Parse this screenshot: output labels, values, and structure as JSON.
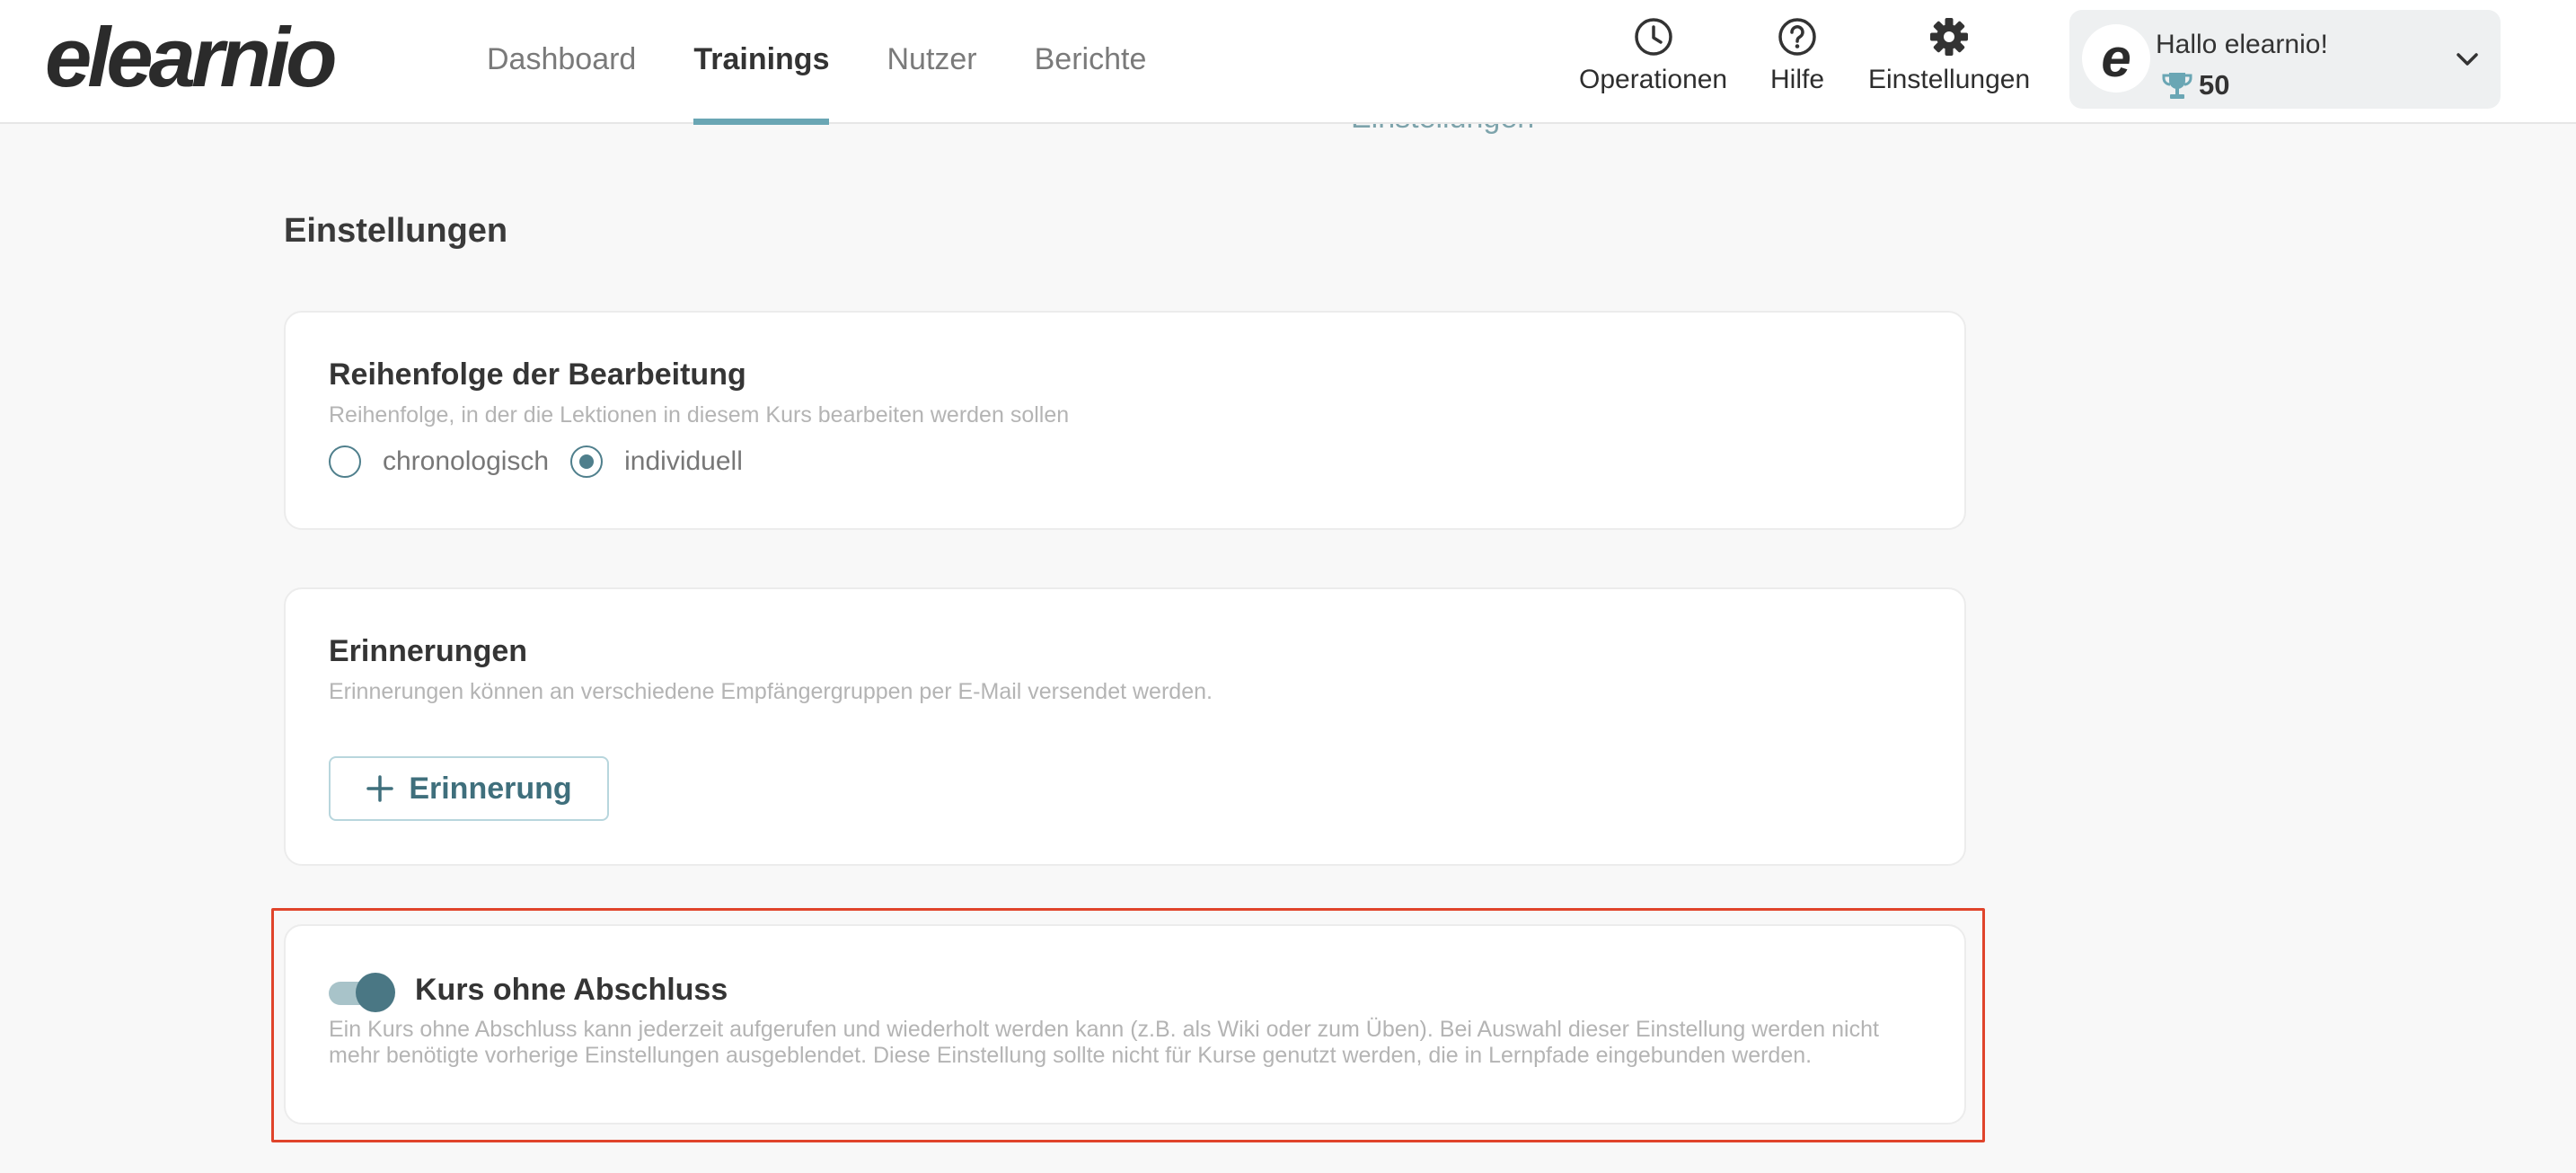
{
  "header": {
    "logo": "elearnio",
    "nav_tabs": [
      {
        "label": "Dashboard",
        "active": false
      },
      {
        "label": "Trainings",
        "active": true
      },
      {
        "label": "Nutzer",
        "active": false
      },
      {
        "label": "Berichte",
        "active": false
      }
    ],
    "icon_nav": {
      "operations": {
        "label": "Operationen",
        "icon": "clock-icon"
      },
      "help": {
        "label": "Hilfe",
        "icon": "help-circle-icon"
      },
      "settings": {
        "label": "Einstellungen",
        "icon": "gear-icon"
      }
    },
    "user": {
      "avatar_letter": "e",
      "greeting": "Hallo elearnio!",
      "points": "50",
      "points_icon": "trophy-icon"
    }
  },
  "ghost_label": "Einstellungen",
  "section": {
    "title": "Einstellungen"
  },
  "order_card": {
    "title": "Reihenfolge der Bearbeitung",
    "description": "Reihenfolge, in der die Lektionen in diesem Kurs bearbeiten werden sollen",
    "options": [
      {
        "label": "chronologisch",
        "checked": false
      },
      {
        "label": "individuell",
        "checked": true
      }
    ]
  },
  "reminder_card": {
    "title": "Erinnerungen",
    "description": "Erinnerungen können an verschiedene Empfängergruppen per E-Mail versendet werden.",
    "add_button": "Erinnerung"
  },
  "no_completion_card": {
    "title": "Kurs ohne Abschluss",
    "toggle_on": true,
    "description_line1": "Ein Kurs ohne Abschluss kann jederzeit aufgerufen und wiederholt werden kann (z.B. als Wiki oder zum Üben). Bei Auswahl dieser Einstellung werden nicht",
    "description_line2": "mehr benötigte vorherige Einstellungen ausgeblendet. Diese Einstellung sollte nicht für Kurse genutzt werden, die in Lernpfade eingebunden werden."
  },
  "colors": {
    "accent": "#4a7784",
    "tab_underline": "#6aa6b4",
    "highlight_border": "#e0442b",
    "trophy": "#6aa6b4"
  }
}
